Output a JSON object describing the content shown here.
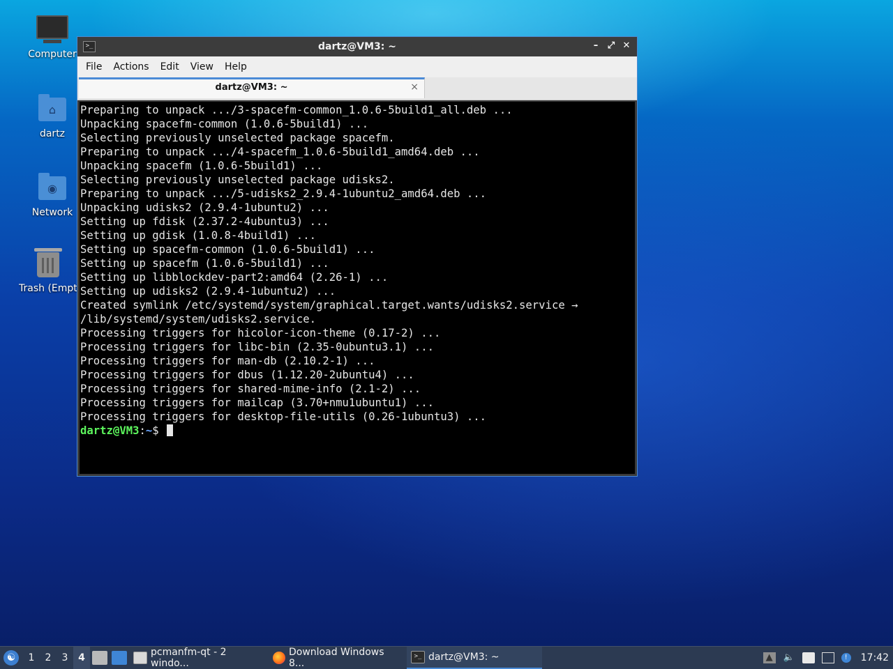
{
  "desktop": {
    "icons": [
      {
        "label": "Computer"
      },
      {
        "label": "dartz"
      },
      {
        "label": "Network"
      },
      {
        "label": "Trash (Empty)"
      }
    ]
  },
  "window": {
    "title": "dartz@VM3: ~",
    "menu": [
      "File",
      "Actions",
      "Edit",
      "View",
      "Help"
    ],
    "tab": {
      "label": "dartz@VM3: ~",
      "close": "×"
    },
    "controls": {
      "minimize": "–",
      "maximize": "⤢",
      "close": "✕"
    }
  },
  "terminal": {
    "lines": [
      "Preparing to unpack .../3-spacefm-common_1.0.6-5build1_all.deb ...",
      "Unpacking spacefm-common (1.0.6-5build1) ...",
      "Selecting previously unselected package spacefm.",
      "Preparing to unpack .../4-spacefm_1.0.6-5build1_amd64.deb ...",
      "Unpacking spacefm (1.0.6-5build1) ...",
      "Selecting previously unselected package udisks2.",
      "Preparing to unpack .../5-udisks2_2.9.4-1ubuntu2_amd64.deb ...",
      "Unpacking udisks2 (2.9.4-1ubuntu2) ...",
      "Setting up fdisk (2.37.2-4ubuntu3) ...",
      "Setting up gdisk (1.0.8-4build1) ...",
      "Setting up spacefm-common (1.0.6-5build1) ...",
      "Setting up spacefm (1.0.6-5build1) ...",
      "Setting up libblockdev-part2:amd64 (2.26-1) ...",
      "Setting up udisks2 (2.9.4-1ubuntu2) ...",
      "Created symlink /etc/systemd/system/graphical.target.wants/udisks2.service →",
      "/lib/systemd/system/udisks2.service.",
      "Processing triggers for hicolor-icon-theme (0.17-2) ...",
      "Processing triggers for libc-bin (2.35-0ubuntu3.1) ...",
      "Processing triggers for man-db (2.10.2-1) ...",
      "Processing triggers for dbus (1.12.20-2ubuntu4) ...",
      "Processing triggers for shared-mime-info (2.1-2) ...",
      "Processing triggers for mailcap (3.70+nmu1ubuntu1) ...",
      "Processing triggers for desktop-file-utils (0.26-1ubuntu3) ..."
    ],
    "prompt": {
      "user": "dartz@VM3",
      "sep": ":",
      "path": "~",
      "symbol": "$ "
    }
  },
  "taskbar": {
    "workspaces": [
      "1",
      "2",
      "3",
      "4"
    ],
    "active_workspace": "4",
    "tasks": [
      {
        "label": "pcmanfm-qt - 2 windo..."
      },
      {
        "label": "Download Windows 8..."
      },
      {
        "label": "dartz@VM3: ~"
      }
    ],
    "clock": "17:42"
  }
}
